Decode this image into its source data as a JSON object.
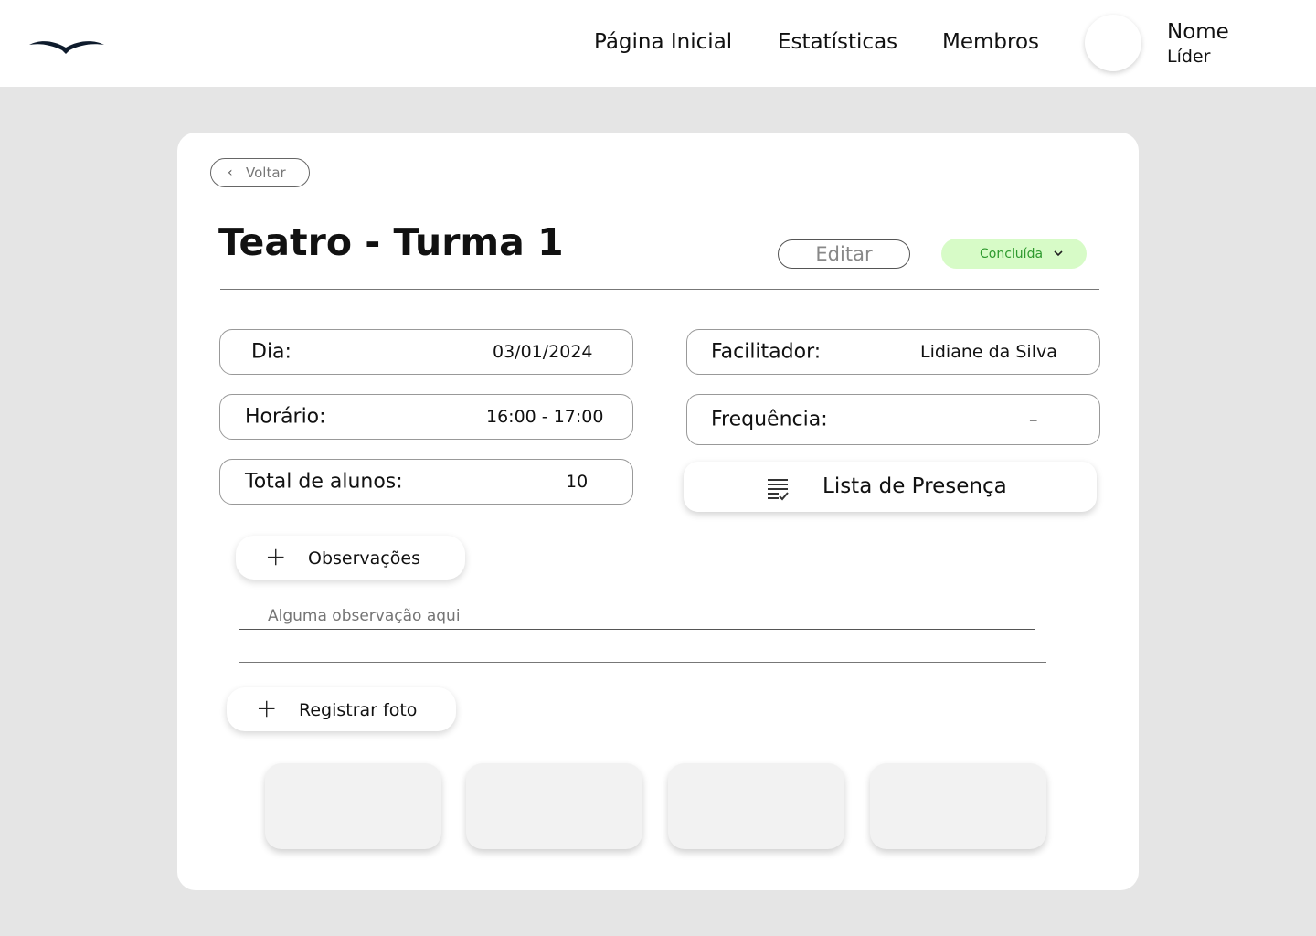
{
  "nav": {
    "links": [
      "Página Inicial",
      "Estatísticas",
      "Membros"
    ],
    "user_name": "Nome",
    "user_role": "Líder"
  },
  "back_label": "Voltar",
  "class_title": "Teatro - Turma 1",
  "edit_label": "Editar",
  "status": {
    "label": "Concluída",
    "color": "#2e9a2e",
    "background": "#d7fbc7"
  },
  "details": {
    "day_label": "Dia:",
    "day_value": "03/01/2024",
    "time_label": "Horário:",
    "time_value": "16:00 - 17:00",
    "students_label": "Total de alunos:",
    "students_value": "10",
    "facilitator_label": "Facilitador:",
    "facilitator_value": "Lidiane da Silva",
    "frequency_label": "Frequência:",
    "frequency_value": "–"
  },
  "attendance_label": "Lista de Presença",
  "observations": {
    "button_label": "Observações",
    "placeholder": "Alguma observação aqui"
  },
  "photo_button_label": "Registrar foto",
  "icons": {
    "logo": "bird-logo-icon",
    "back": "chevron-left-icon",
    "status": "chevron-down-icon",
    "attendance": "checklist-icon",
    "add": "plus-icon"
  }
}
